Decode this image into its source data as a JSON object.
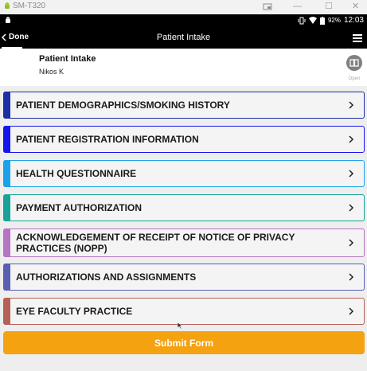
{
  "window": {
    "title": "SM-T320",
    "minimize_glyph": "—",
    "restore_glyph": "☐",
    "close_glyph": "✕"
  },
  "status_bar": {
    "battery": "92%",
    "time": "12:03"
  },
  "app_bar": {
    "back_label": "Done",
    "title": "Patient Intake"
  },
  "form": {
    "name": "Patient Intake",
    "user": "Nikos K",
    "open_label": "Open"
  },
  "sections": [
    {
      "label": "PATIENT DEMOGRAPHICS/SMOKING HISTORY",
      "color": "#1c2fa6"
    },
    {
      "label": "PATIENT REGISTRATION INFORMATION",
      "color": "#1515ee"
    },
    {
      "label": "HEALTH QUESTIONNAIRE",
      "color": "#1aa3ea"
    },
    {
      "label": "PAYMENT AUTHORIZATION",
      "color": "#17a39a"
    },
    {
      "label": "ACKNOWLEDGEMENT OF RECEIPT OF NOTICE OF PRIVACY PRACTICES (NOPP)",
      "color": "#b574c4"
    },
    {
      "label": "AUTHORIZATIONS AND ASSIGNMENTS",
      "color": "#5a5fb3"
    },
    {
      "label": "EYE FACULTY PRACTICE",
      "color": "#b46258"
    }
  ],
  "submit_label": "Submit Form",
  "colors": {
    "accent": "#f5a211",
    "app_bar": "#000000"
  }
}
